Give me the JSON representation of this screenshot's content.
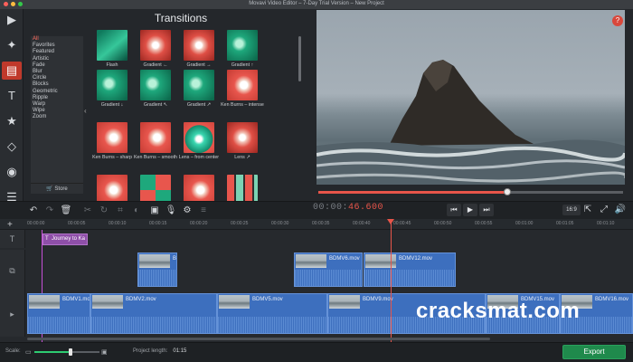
{
  "window": {
    "title": "Movavi Video Editor – 7-Day Trial Version – New Project",
    "traffic_lights": [
      "#fc605b",
      "#fdbc40",
      "#34c84a"
    ]
  },
  "sidebar": {
    "tools": [
      {
        "name": "import-media-icon",
        "glyph": "▶"
      },
      {
        "name": "magic-wand-icon",
        "glyph": "✦"
      },
      {
        "name": "transitions-icon",
        "glyph": "▤",
        "active": true
      },
      {
        "name": "titles-icon",
        "glyph": "T"
      },
      {
        "name": "stickers-icon",
        "glyph": "★"
      },
      {
        "name": "shapes-icon",
        "glyph": "◇"
      },
      {
        "name": "stabilization-icon",
        "glyph": "◉"
      },
      {
        "name": "more-tools-icon",
        "glyph": "☰"
      }
    ]
  },
  "transitions": {
    "title": "Transitions",
    "categories": [
      "All",
      "Favorites",
      "Featured",
      "Artistic",
      "Fade",
      "Blur",
      "Circle",
      "Blocks",
      "Geometric",
      "Ripple",
      "Warp",
      "Wipe",
      "Zoom"
    ],
    "selected_category": "All",
    "store_label": "Store",
    "items": [
      {
        "label": "Flash",
        "style": "flash"
      },
      {
        "label": "Gradient ←",
        "style": "redgrad"
      },
      {
        "label": "Gradient →",
        "style": "redgrad"
      },
      {
        "label": "Gradient ↑",
        "style": "green"
      },
      {
        "label": "Gradient ↓",
        "style": "green"
      },
      {
        "label": "Gradient ↖",
        "style": "green"
      },
      {
        "label": "Gradient ↗",
        "style": "green"
      },
      {
        "label": "Ken Burns – intense",
        "style": "red"
      },
      {
        "label": "Ken Burns – sharp",
        "style": "red"
      },
      {
        "label": "Ken Burns – smooth",
        "style": "red"
      },
      {
        "label": "Lens – from center",
        "style": "lens"
      },
      {
        "label": "Lens ↗",
        "style": "redgrad"
      },
      {
        "label": "",
        "style": "red"
      },
      {
        "label": "",
        "style": "mosaic"
      },
      {
        "label": "",
        "style": "red"
      },
      {
        "label": "",
        "style": "tiles"
      }
    ]
  },
  "preview": {
    "help_glyph": "?",
    "progress": 0.62
  },
  "toolbar": {
    "timecode_dim": "00:00:",
    "timecode_hi": "46.600",
    "ratio_label": "16:9"
  },
  "ruler": {
    "ticks": [
      "00:00:00",
      "00:00:05",
      "00:00:10",
      "00:00:15",
      "00:00:20",
      "00:00:25",
      "00:00:30",
      "00:00:35",
      "00:00:40",
      "00:00:45",
      "00:00:50",
      "00:00:55",
      "00:01:00",
      "00:01:05",
      "00:01:10"
    ]
  },
  "timeline": {
    "title_clip": "Journey to Ka",
    "overlay_clips": [
      {
        "name": "BI"
      },
      {
        "name": "BDMV6.mov"
      },
      {
        "name": "BDMV12.mov"
      }
    ],
    "main_clips": [
      {
        "name": "BDMV1.mov"
      },
      {
        "name": "BDMV2.mov"
      },
      {
        "name": "BDMV5.mov"
      },
      {
        "name": "BDMV9.mov"
      },
      {
        "name": "BDMV15.mov"
      },
      {
        "name": "BDMV16.mov"
      }
    ]
  },
  "bottom": {
    "scale_label": "Scale:",
    "scale_level": 0.55,
    "project_length_label": "Project length:",
    "project_length_value": "01:15",
    "export_label": "Export"
  },
  "watermark": "cracksmat.com"
}
